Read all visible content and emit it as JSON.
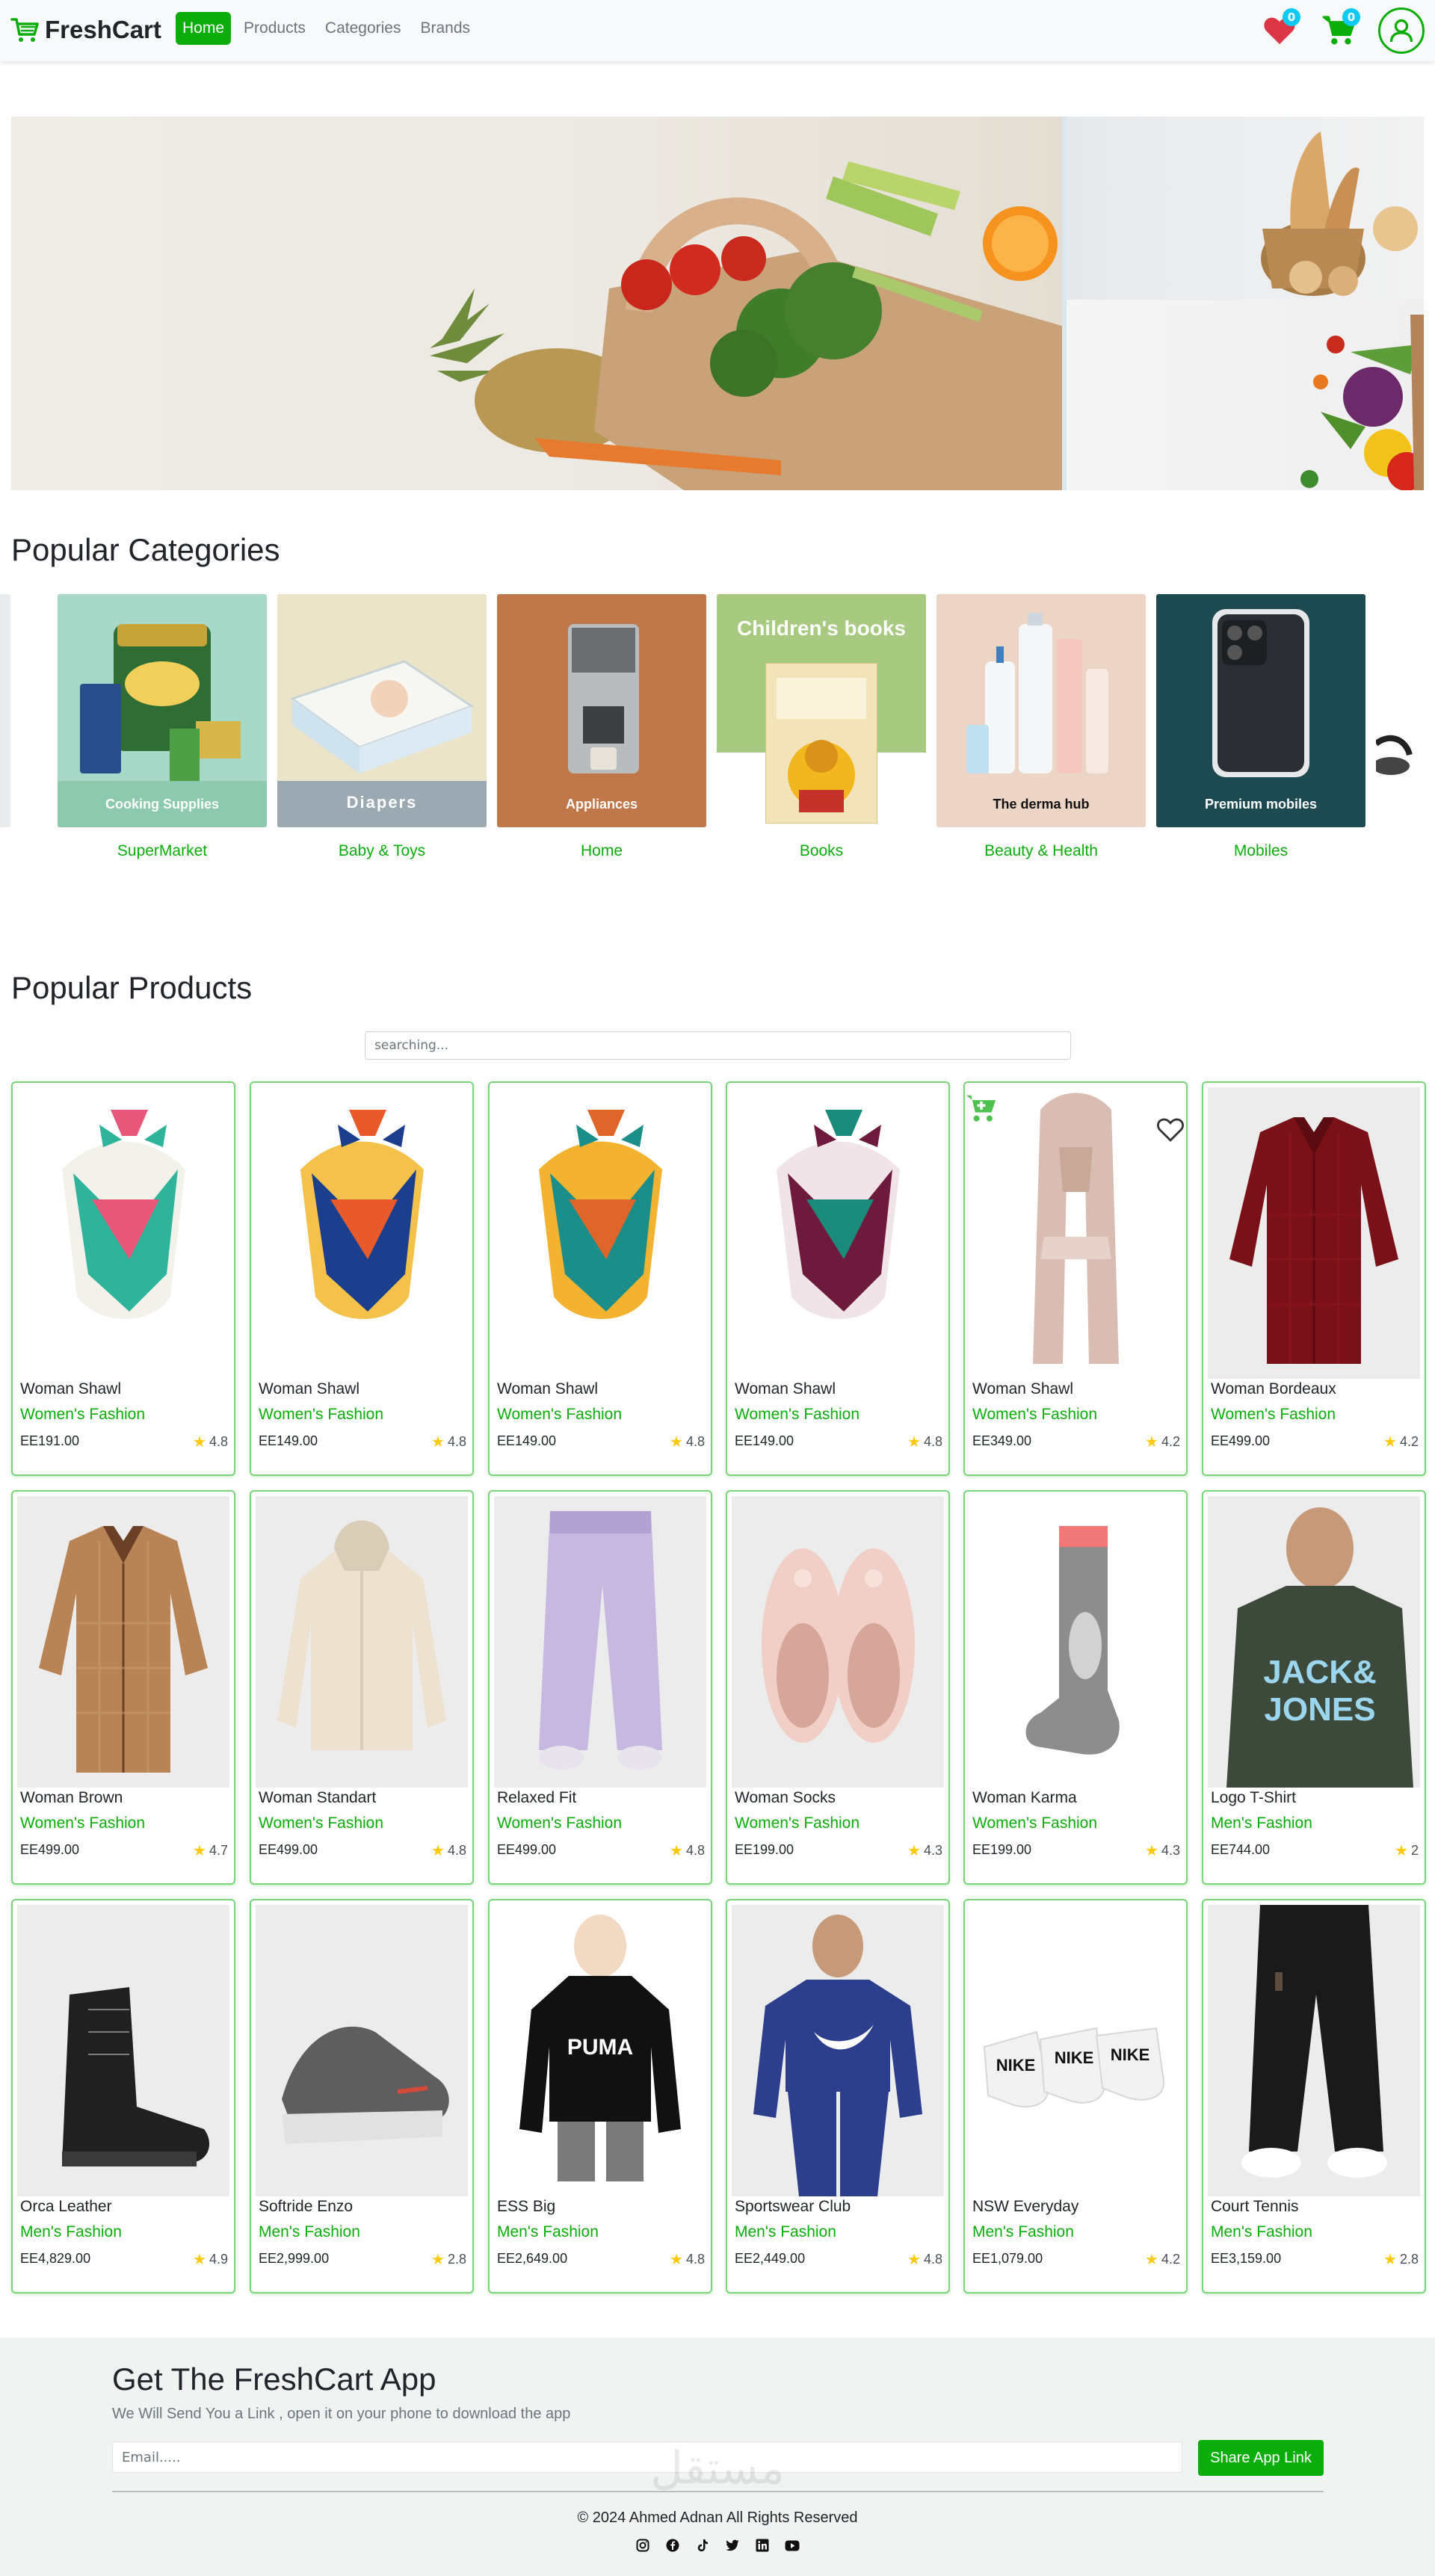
{
  "brand": {
    "name": "FreshCart"
  },
  "nav": {
    "links": [
      {
        "label": "Home",
        "active": true
      },
      {
        "label": "Products",
        "active": false
      },
      {
        "label": "Categories",
        "active": false
      },
      {
        "label": "Brands",
        "active": false
      }
    ],
    "wishlist_count": "0",
    "cart_count": "0",
    "icons": [
      "heart-icon",
      "cart-icon",
      "user-icon"
    ]
  },
  "hero": {
    "images": [
      "grocery-bag-vegetables",
      "bread-basket",
      "vegetables-pouring"
    ]
  },
  "categories": {
    "title": "Popular Categories",
    "items": [
      {
        "name": "SuperMarket",
        "image_label": "Cooking Supplies"
      },
      {
        "name": "Baby & Toys",
        "image_label": "Diapers"
      },
      {
        "name": "Home",
        "image_label": "Appliances"
      },
      {
        "name": "Books",
        "image_label": "Children's books"
      },
      {
        "name": "Beauty & Health",
        "image_label": "The derma hub"
      },
      {
        "name": "Mobiles",
        "image_label": "Premium mobiles"
      }
    ]
  },
  "products": {
    "title": "Popular Products",
    "search_placeholder": "searching...",
    "items": [
      {
        "title": "Woman Shawl",
        "category": "Women's Fashion",
        "price": "EE191.00",
        "rating": "4.8"
      },
      {
        "title": "Woman Shawl",
        "category": "Women's Fashion",
        "price": "EE149.00",
        "rating": "4.8"
      },
      {
        "title": "Woman Shawl",
        "category": "Women's Fashion",
        "price": "EE149.00",
        "rating": "4.8"
      },
      {
        "title": "Woman Shawl",
        "category": "Women's Fashion",
        "price": "EE149.00",
        "rating": "4.8"
      },
      {
        "title": "Woman Shawl",
        "category": "Women's Fashion",
        "price": "EE349.00",
        "rating": "4.2"
      },
      {
        "title": "Woman Bordeaux",
        "category": "Women's Fashion",
        "price": "EE499.00",
        "rating": "4.2"
      },
      {
        "title": "Woman Brown",
        "category": "Women's Fashion",
        "price": "EE499.00",
        "rating": "4.7"
      },
      {
        "title": "Woman Standart",
        "category": "Women's Fashion",
        "price": "EE499.00",
        "rating": "4.8"
      },
      {
        "title": "Relaxed Fit",
        "category": "Women's Fashion",
        "price": "EE499.00",
        "rating": "4.8"
      },
      {
        "title": "Woman Socks",
        "category": "Women's Fashion",
        "price": "EE199.00",
        "rating": "4.3"
      },
      {
        "title": "Woman Karma",
        "category": "Women's Fashion",
        "price": "EE199.00",
        "rating": "4.3"
      },
      {
        "title": "Logo T-Shirt",
        "category": "Men's Fashion",
        "price": "EE744.00",
        "rating": "2"
      },
      {
        "title": "Orca Leather",
        "category": "Men's Fashion",
        "price": "EE4,829.00",
        "rating": "4.9"
      },
      {
        "title": "Softride Enzo",
        "category": "Men's Fashion",
        "price": "EE2,999.00",
        "rating": "2.8"
      },
      {
        "title": "ESS Big",
        "category": "Men's Fashion",
        "price": "EE2,649.00",
        "rating": "4.8"
      },
      {
        "title": "Sportswear Club",
        "category": "Men's Fashion",
        "price": "EE2,449.00",
        "rating": "4.8"
      },
      {
        "title": "NSW Everyday",
        "category": "Men's Fashion",
        "price": "EE1,079.00",
        "rating": "4.2"
      },
      {
        "title": "Court Tennis",
        "category": "Men's Fashion",
        "price": "EE3,159.00",
        "rating": "2.8"
      }
    ]
  },
  "footer": {
    "title": "Get The FreshCart App",
    "subtitle": "We Will Send You a Link , open it on your phone to download the app",
    "email_placeholder": "Email.....",
    "button_label": "Share App Link",
    "copyright": "© 2024 Ahmed Adnan All Rights Reserved",
    "social": [
      "instagram-icon",
      "facebook-icon",
      "tiktok-icon",
      "twitter-icon",
      "linkedin-icon",
      "youtube-icon"
    ],
    "watermark": "مستقل"
  },
  "colors": {
    "accent": "#0aad0a",
    "badge": "#0dcaf0",
    "heart": "#dc3545",
    "star": "#ffc908"
  }
}
